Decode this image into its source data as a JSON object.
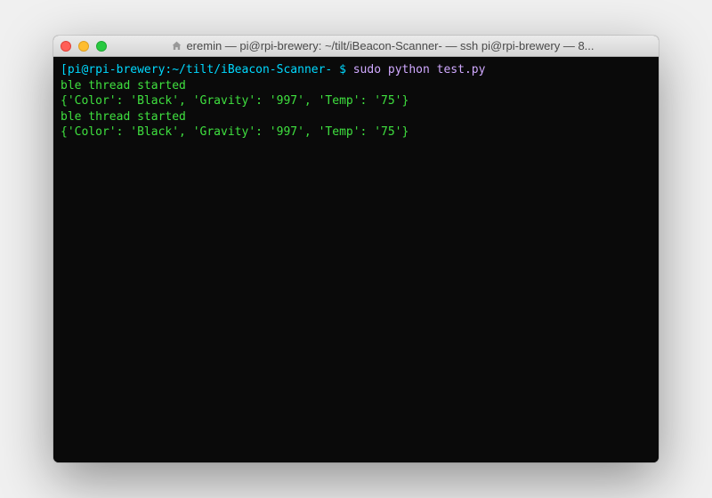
{
  "window": {
    "title": "eremin — pi@rpi-brewery: ~/tilt/iBeacon-Scanner- — ssh pi@rpi-brewery — 8..."
  },
  "terminal": {
    "prompt": {
      "user_host": "[pi@rpi-brewery:",
      "path": "~/tilt/iBeacon-Scanner-",
      "bracket_dollar": " $ "
    },
    "command": "sudo python test.py",
    "output_lines": [
      "ble thread started",
      "{'Color': 'Black', 'Gravity': '997', 'Temp': '75'}",
      "ble thread started",
      "{'Color': 'Black', 'Gravity': '997', 'Temp': '75'}"
    ]
  }
}
